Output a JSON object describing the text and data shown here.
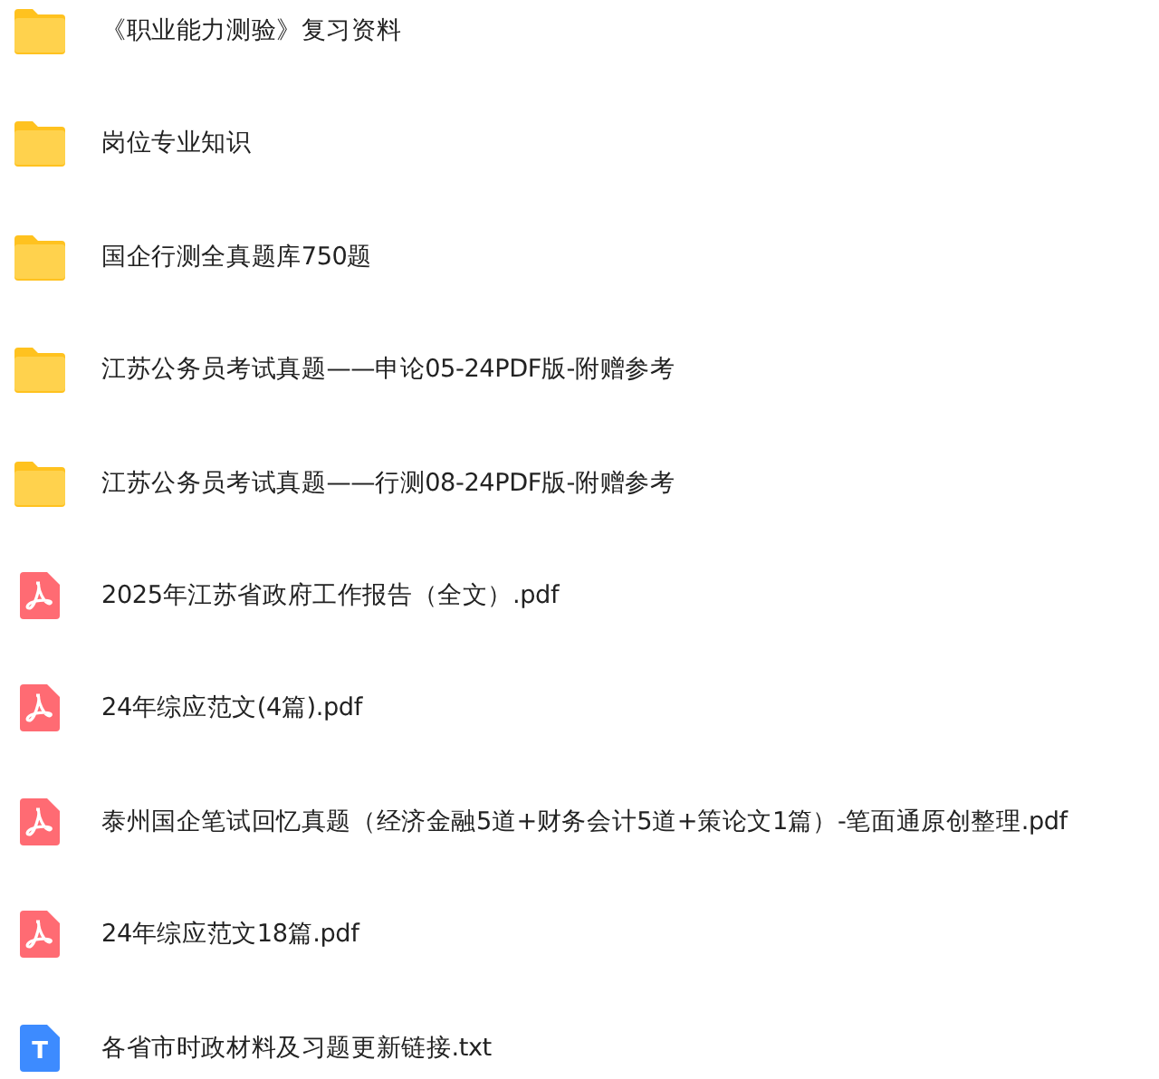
{
  "files": [
    {
      "kind": "folder",
      "name": "《职业能力测验》复习资料"
    },
    {
      "kind": "folder",
      "name": "岗位专业知识"
    },
    {
      "kind": "folder",
      "name": "国企行测全真题库750题"
    },
    {
      "kind": "folder",
      "name": "江苏公务员考试真题——申论05-24PDF版-附赠参考"
    },
    {
      "kind": "folder",
      "name": "江苏公务员考试真题——行测08-24PDF版-附赠参考"
    },
    {
      "kind": "pdf",
      "name": "2025年江苏省政府工作报告（全文）.pdf"
    },
    {
      "kind": "pdf",
      "name": "24年综应范文(4篇).pdf"
    },
    {
      "kind": "pdf",
      "name": "泰州国企笔试回忆真题（经济金融5道+财务会计5道+策论文1篇）-笔面通原创整理.pdf"
    },
    {
      "kind": "pdf",
      "name": "24年综应范文18篇.pdf"
    },
    {
      "kind": "txt",
      "name": "各省市时政材料及习题更新链接.txt",
      "icon_letter": "T"
    }
  ]
}
